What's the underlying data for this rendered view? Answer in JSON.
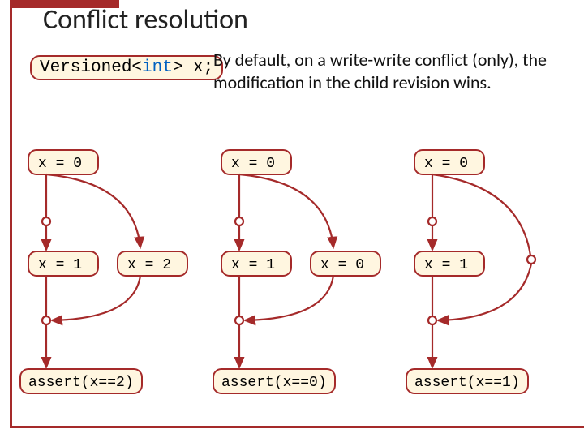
{
  "title": "Conflict resolution",
  "declaration": {
    "prefix": "Versioned<",
    "type": "int",
    "suffix": "> x;"
  },
  "description": "By default, on a write-write conflict (only), the modification in the child revision wins.",
  "graphs": [
    {
      "init": "x = 0",
      "left": "x = 1",
      "right": "x = 2",
      "assert": "assert(x==2)"
    },
    {
      "init": "x = 0",
      "left": "x = 1",
      "right": "x = 0",
      "assert": "assert(x==0)"
    },
    {
      "init": "x = 0",
      "left": "x = 1",
      "right": null,
      "assert": "assert(x==1)"
    }
  ]
}
